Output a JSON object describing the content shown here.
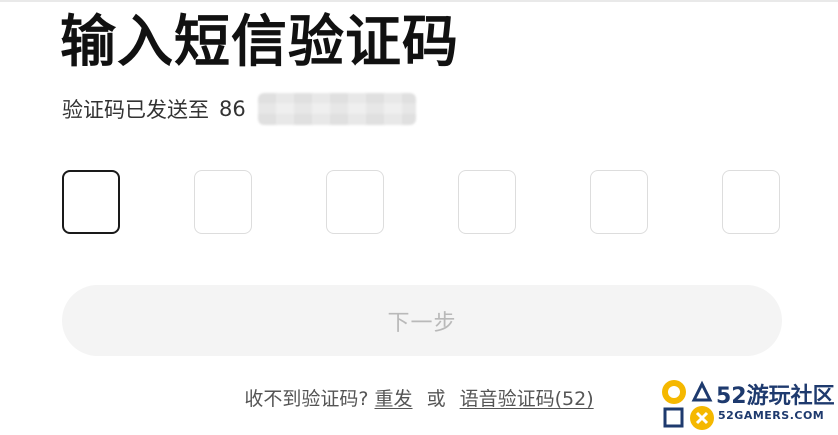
{
  "page": {
    "title": "输入短信验证码",
    "subtitle_prefix": "验证码已发送至",
    "country_code": "86"
  },
  "code_boxes": [
    "",
    "",
    "",
    "",
    "",
    ""
  ],
  "next_button": {
    "label": "下一步"
  },
  "help": {
    "question": "收不到验证码?",
    "resend_label": "重发",
    "or_label": "或",
    "voice_label": "语音验证码(52)"
  },
  "watermark": {
    "brand_top": "52游玩社区",
    "brand_bottom": "52GAMERS.COM",
    "colors": {
      "yellow": "#f5b800",
      "navy": "#1e3a6e"
    }
  }
}
